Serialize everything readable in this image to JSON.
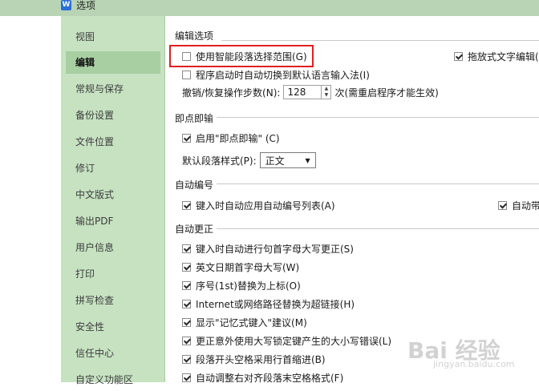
{
  "window": {
    "title": "选项",
    "icon": "W"
  },
  "sidebar": {
    "items": [
      {
        "label": "视图"
      },
      {
        "label": "编辑",
        "active": true
      },
      {
        "label": "常规与保存"
      },
      {
        "label": "备份设置"
      },
      {
        "label": "文件位置"
      },
      {
        "label": "修订"
      },
      {
        "label": "中文版式"
      },
      {
        "label": "输出PDF"
      },
      {
        "label": "用户信息"
      },
      {
        "label": "打印"
      },
      {
        "label": "拼写检查"
      },
      {
        "label": "安全性"
      },
      {
        "label": "信任中心"
      },
      {
        "label": "自定义功能区"
      }
    ]
  },
  "edit_options": {
    "title": "编辑选项",
    "smart_paragraph": {
      "label": "使用智能段落选择范围(G)",
      "checked": false
    },
    "drag_drop": {
      "label": "拖放式文字编辑(",
      "checked": true
    },
    "auto_keyboard": {
      "label": "程序启动时自动切换到默认语言输入法(I)",
      "checked": false
    },
    "undo_label": "撤销/恢复操作步数(N):",
    "undo_value": "128",
    "undo_suffix": "次(需重启程序才能生效)"
  },
  "click_type": {
    "title": "即点即输",
    "enable": {
      "label": "启用\"即点即输\" (C)",
      "checked": true
    },
    "default_style_label": "默认段落样式(P):",
    "default_style_value": "正文"
  },
  "auto_numbering": {
    "title": "自动编号",
    "auto_list": {
      "label": "键入时自动应用自动编号列表(A)",
      "checked": true
    },
    "auto_other": {
      "label": "自动带",
      "checked": true
    }
  },
  "auto_correct": {
    "title": "自动更正",
    "items": [
      {
        "label": "键入时自动进行句首字母大写更正(S)",
        "checked": true
      },
      {
        "label": "英文日期首字母大写(W)",
        "checked": true
      },
      {
        "label": "序号(1st)替换为上标(O)",
        "checked": true
      },
      {
        "label": "Internet或网络路径替换为超链接(H)",
        "checked": true
      },
      {
        "label": "显示\"记忆式键入\"建议(M)",
        "checked": true
      },
      {
        "label": "更正意外使用大写锁定键产生的大小写错误(L)",
        "checked": true
      },
      {
        "label": "段落开头空格采用行首缩进(B)",
        "checked": true
      },
      {
        "label": "自动调整右对齐段落末空格格式(F)",
        "checked": true
      }
    ]
  },
  "watermark": {
    "text": "Bai 经验",
    "sub": "jingyan.baidu.com"
  }
}
